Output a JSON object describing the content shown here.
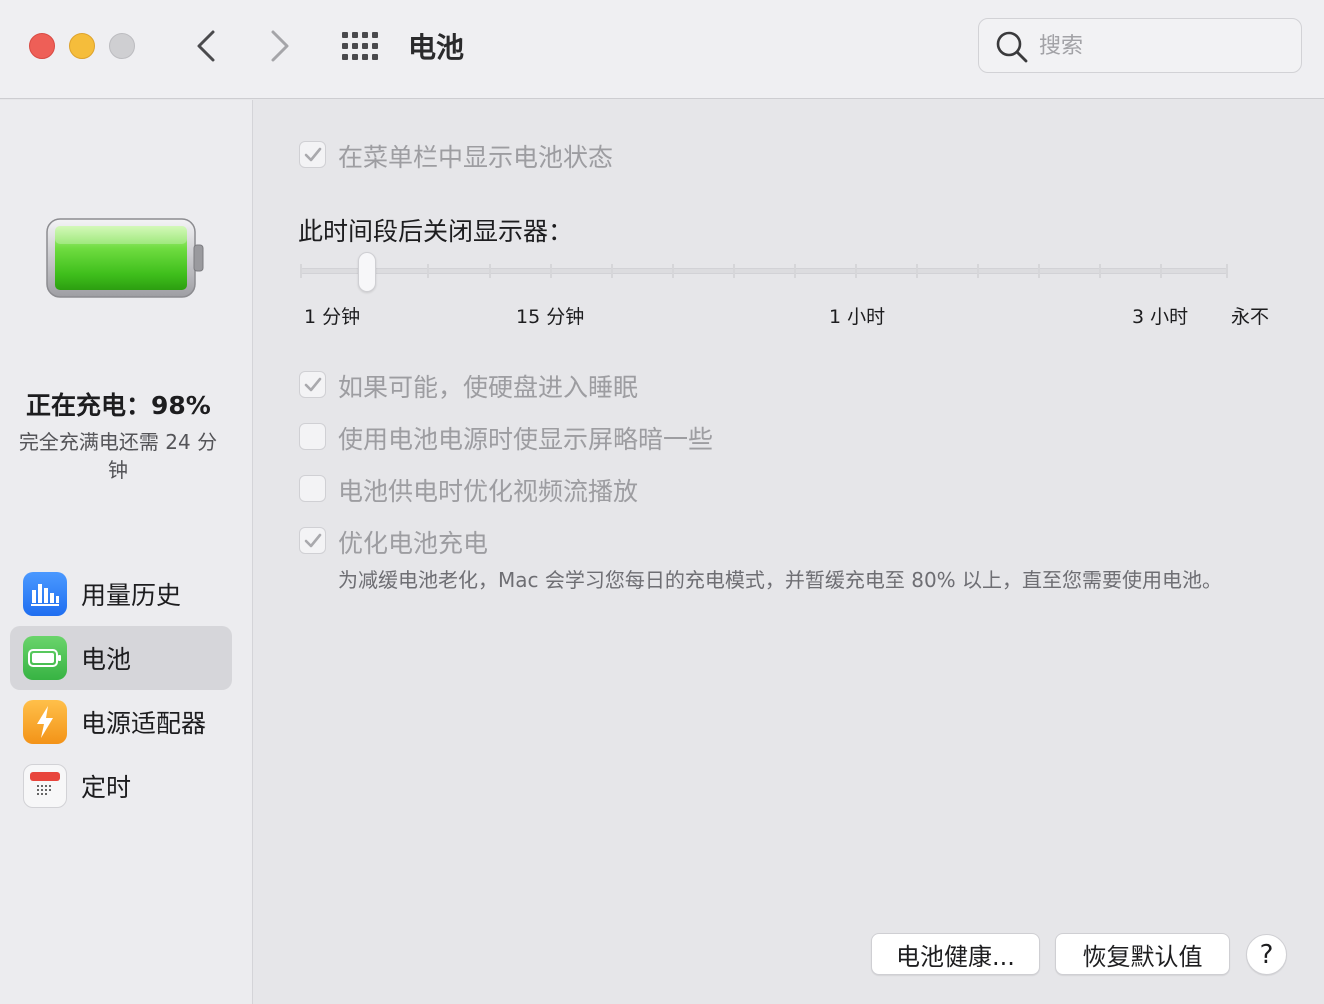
{
  "window": {
    "title": "电池",
    "search_placeholder": "搜索"
  },
  "sidebar": {
    "charge_status": "正在充电：98%",
    "charge_remaining": "完全充满电还需 24 分钟",
    "battery_level_percent": 98,
    "items": [
      {
        "label": "用量历史",
        "icon": "chart-icon",
        "color": "#2f7cf6",
        "selected": false
      },
      {
        "label": "电池",
        "icon": "battery-icon",
        "color": "#4cc25a",
        "selected": true
      },
      {
        "label": "电源适配器",
        "icon": "lightning-icon",
        "color": "#f5a623",
        "selected": false
      },
      {
        "label": "定时",
        "icon": "calendar-icon",
        "color": "#e8453c",
        "selected": false
      }
    ]
  },
  "main": {
    "show_in_menubar": {
      "label": "在菜单栏中显示电池状态",
      "checked": true
    },
    "display_off_label": "此时间段后关闭显示器：",
    "slider": {
      "value": "2 分钟",
      "ticks": [
        "1 分钟",
        "15 分钟",
        "1 小时",
        "3 小时",
        "永不"
      ]
    },
    "options": [
      {
        "label": "如果可能，使硬盘进入睡眠",
        "checked": true
      },
      {
        "label": "使用电池电源时使显示屏略暗一些",
        "checked": false
      },
      {
        "label": "电池供电时优化视频流播放",
        "checked": false
      },
      {
        "label": "优化电池充电",
        "checked": true
      }
    ],
    "optimize_description": "为减缓电池老化，Mac 会学习您每日的充电模式，并暂缓充电至 80% 以上，直至您需要使用电池。",
    "buttons": {
      "battery_health": "电池健康...",
      "restore_defaults": "恢复默认值",
      "help": "?"
    }
  }
}
